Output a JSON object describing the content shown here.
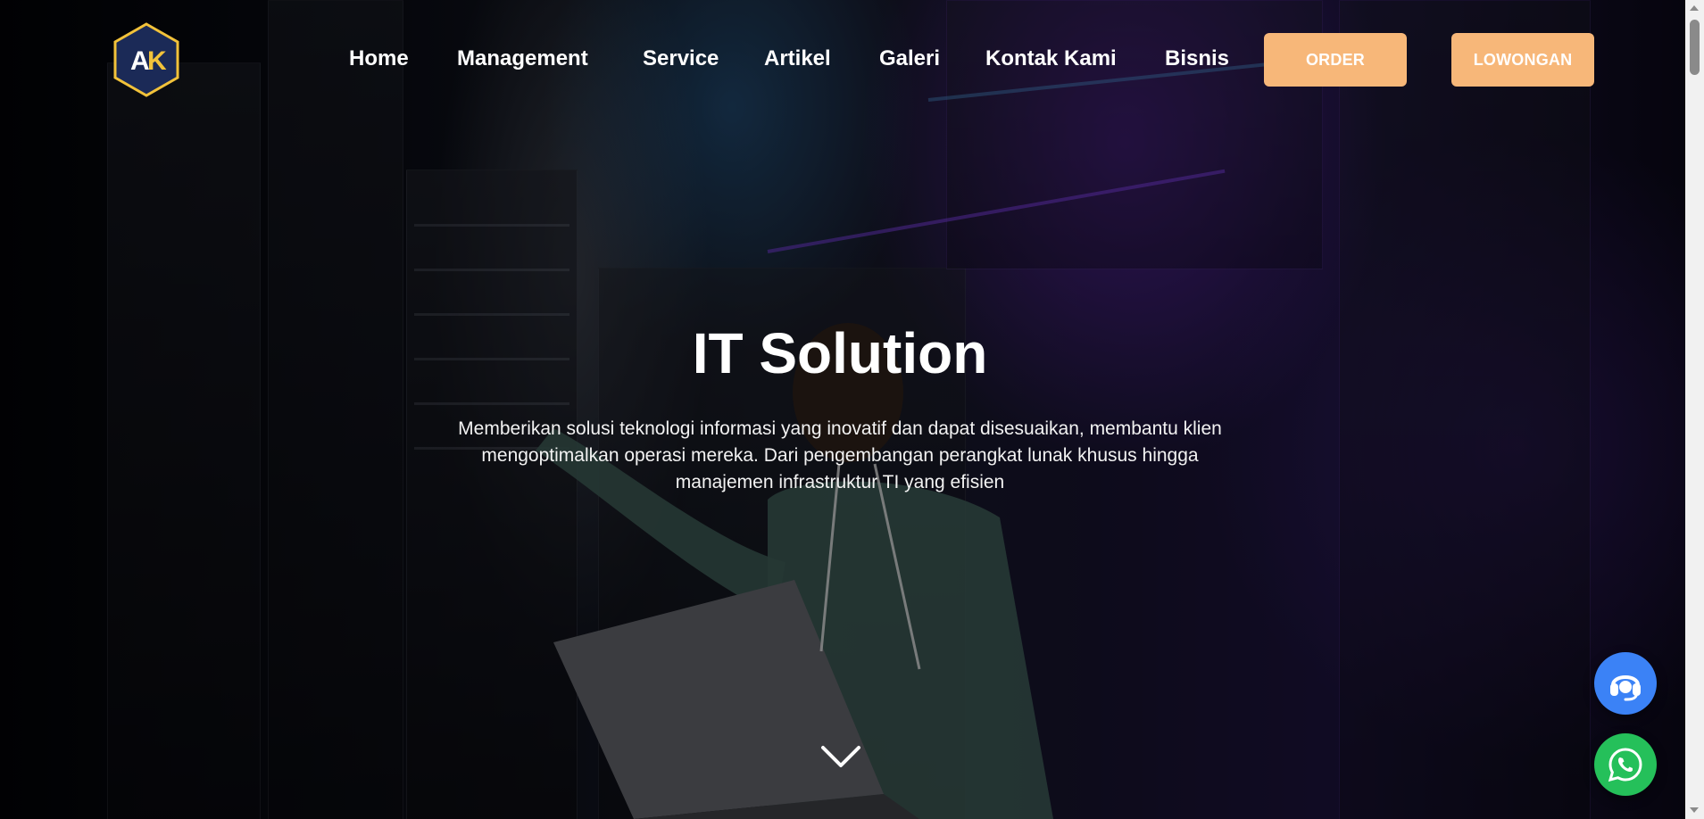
{
  "header": {
    "logo_text": "AK",
    "nav_items": [
      {
        "label": "Home"
      },
      {
        "label": "Management"
      },
      {
        "label": "Service"
      },
      {
        "label": "Artikel"
      },
      {
        "label": "Galeri"
      },
      {
        "label": "Kontak Kami"
      },
      {
        "label": "Bisnis"
      }
    ],
    "order_label": "ORDER",
    "lowongan_label": "LOWONGAN"
  },
  "hero": {
    "title": "IT Solution",
    "description": "Memberikan solusi teknologi informasi yang inovatif dan dapat disesuaikan, membantu klien mengoptimalkan operasi mereka. Dari pengembangan perangkat lunak khusus hingga manajemen infrastruktur TI yang efisien"
  },
  "floating": {
    "support_icon": "headset-icon",
    "whatsapp_icon": "whatsapp-icon"
  },
  "colors": {
    "accent": "#f7b779",
    "support": "#3b82f6",
    "whatsapp": "#25c05a",
    "logo_bg": "#1b2a57",
    "logo_border": "#f2c23a"
  }
}
